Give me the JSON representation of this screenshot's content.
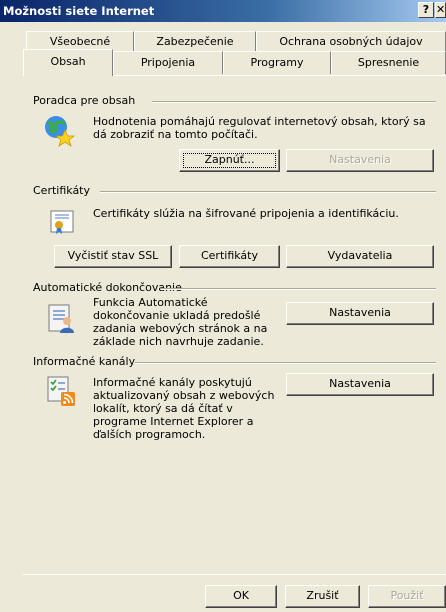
{
  "window": {
    "title": "Možnosti siete Internet",
    "help_label": "?",
    "close_label": "✕"
  },
  "tabs_row1": [
    "Všeobecné",
    "Zabezpečenie",
    "Ochrana osobných údajov"
  ],
  "tabs_row2": [
    "Obsah",
    "Pripojenia",
    "Programy",
    "Spresnenie"
  ],
  "active_tab": "Obsah",
  "content_advisor": {
    "group_label": "Poradca pre obsah",
    "description": "Hodnotenia pomáhajú regulovať internetový obsah, ktorý sa dá zobraziť na tomto počítači.",
    "enable_button": "Zapnúť...",
    "settings_button": "Nastavenia"
  },
  "certificates": {
    "group_label": "Certifikáty",
    "description": "Certifikáty slúžia na šifrované pripojenia a identifikáciu.",
    "clear_ssl_button": "Vyčistiť stav SSL",
    "certificates_button": "Certifikáty",
    "publishers_button": "Vydavatelia"
  },
  "autocomplete": {
    "group_label": "Automatické dokončovanie",
    "description": "Funkcia Automatické dokončovanie ukladá predošlé zadania webových stránok a na základe nich navrhuje zadanie.",
    "settings_button": "Nastavenia"
  },
  "feeds": {
    "group_label": "Informačné kanály",
    "description": "Informačné kanály poskytujú aktualizovaný obsah z webových lokalít, ktorý sa dá čítať v programe Internet Explorer a ďalších programoch.",
    "settings_button": "Nastavenia"
  },
  "footer": {
    "ok_button": "OK",
    "cancel_button": "Zrušiť",
    "apply_button": "Použiť"
  },
  "icons": {
    "content_advisor": "globe-star-icon",
    "certificates": "certificate-icon",
    "autocomplete": "autocomplete-form-icon",
    "feeds": "rss-feed-icon"
  }
}
